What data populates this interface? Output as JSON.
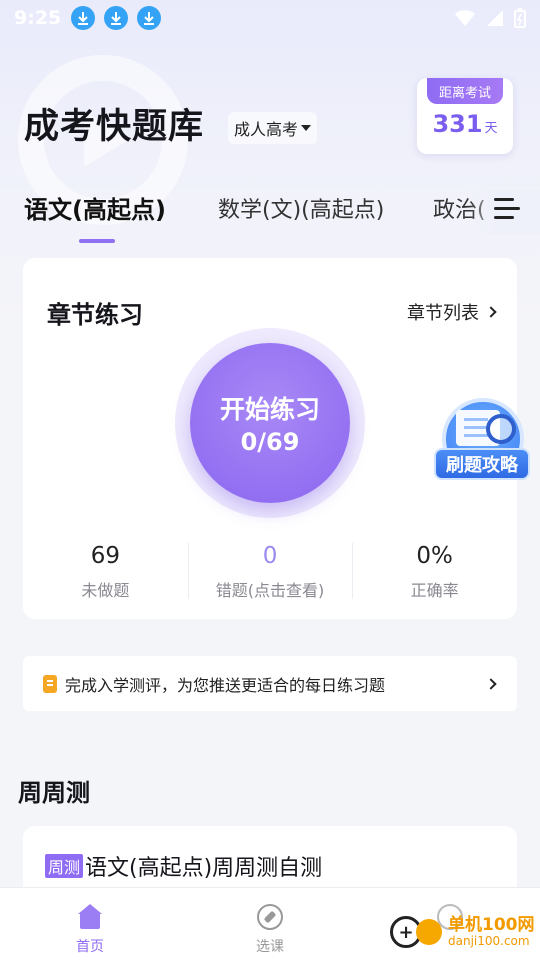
{
  "status_bar": {
    "time": "9:25"
  },
  "header": {
    "title": "成考快题库",
    "exam_type": "成人高考",
    "countdown": {
      "label": "距离考试",
      "value": "331",
      "unit": "天"
    }
  },
  "tabs": [
    {
      "label": "语文(高起点)"
    },
    {
      "label": "数学(文)(高起点)"
    },
    {
      "label": "政治("
    }
  ],
  "chapter_card": {
    "title": "章节练习",
    "list_link": "章节列表",
    "start_label": "开始练习",
    "start_progress": "0/69",
    "stats": [
      {
        "value": "69",
        "label": "未做题"
      },
      {
        "value": "0",
        "label": "错题(点击查看)"
      },
      {
        "value": "0%",
        "label": "正确率"
      }
    ]
  },
  "guide_badge": {
    "label": "刷题攻略"
  },
  "banner": {
    "text": "完成入学测评，为您推送更适合的每日练习题"
  },
  "weekly": {
    "section_title": "周周测",
    "tag": "周测",
    "item_title": "语文(高起点)周周测自测"
  },
  "bottom_nav": [
    {
      "label": "首页",
      "icon": "home-icon",
      "active": true
    },
    {
      "label": "选课",
      "icon": "compass-icon",
      "active": false
    },
    {
      "label": "",
      "icon": "profile-icon",
      "active": false
    }
  ],
  "watermark": {
    "name": "单机100网",
    "url": "danji100.com"
  }
}
